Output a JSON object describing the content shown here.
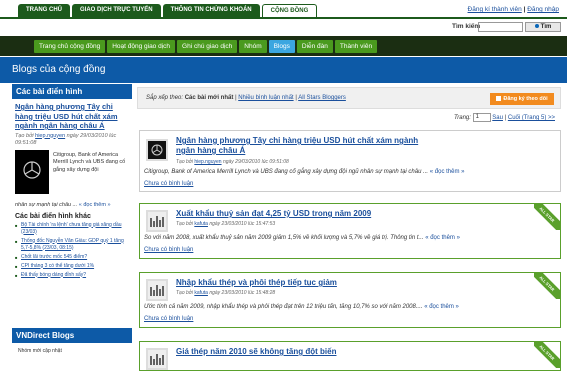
{
  "top_tabs": [
    "TRANG CHỦ",
    "GIAO DỊCH TRỰC TUYẾN",
    "THÔNG TIN CHỨNG KHOÁN",
    "CỘNG ĐỒNG"
  ],
  "top_links": {
    "register": "Đăng kí thành viên",
    "separator": "|",
    "login": "Đăng nhập"
  },
  "search": {
    "label": "Tìm kiếm",
    "placeholder": "",
    "button": "Tìm"
  },
  "green_nav": [
    "Trang chủ cộng đồng",
    "Hoạt động giao dịch",
    "Ghi chú giao dịch",
    "Nhóm",
    "Blogs",
    "Diễn đàn",
    "Thành viên"
  ],
  "page_title": "Blogs của cộng đồng",
  "sidebar": {
    "featured_header": "Các bài điển hình",
    "featured": {
      "title": "Ngân hàng phương Tây chi hàng triệu USD hút chất xám ngành ngân hàng châu Á",
      "meta_prefix": "Tạo bởi",
      "author": "hiep.nguyen",
      "meta_suffix": "ngày 29/03/2010 lúc 09:51:08",
      "text": "Citigroup, Bank of America Merrill Lynch và UBS đang cố gắng xây dựng đội",
      "tail": "nhân sự mạnh tại châu ...",
      "more": "« đọc thêm »"
    },
    "others_header": "Các bài điển hình khác",
    "others": [
      "Bộ Tài chính 'ra lệnh' chưa tăng giá xăng dầu (23/03)",
      "Thống đốc Nguyễn Văn Giàu: GDP quý 1 tăng 5,7-5,8% (23/03, 08:15)",
      "Chốt lãi trước mốc 545 điểm?",
      "CPI tháng 3 có thể tăng dưới 1%",
      "Đã thấy bóng dáng đỉnh sấy?"
    ],
    "blogs_header": "VNDirect Blogs",
    "blogs_bottom": "Nhóm mới cập nhật"
  },
  "sortbar": {
    "label": "Sắp xếp theo:",
    "newest": "Các bài mới nhất",
    "sep1": "|",
    "most_discussed": "Nhiều bình luận nhất",
    "sep2": "|",
    "all_bloggers": "All Stars Bloggers",
    "subscribe": "Đăng ký theo dõi"
  },
  "pager": {
    "label": "Trang:",
    "value": "1",
    "next": "Sau",
    "sep": "|",
    "last": "Cuối (Trang 5) >>"
  },
  "posts": [
    {
      "title": "Ngân hàng phương Tây chi hàng triệu USD hút chất xám ngành ngân hàng châu Á",
      "meta_prefix": "Tạo bởi",
      "author": "hiep.nguyen",
      "meta_suffix": "ngày 29/03/2010 lúc 09:51:08",
      "body": "Citigroup, Bank of America Merrill Lynch và UBS đang cố gắng xây dựng đội ngũ nhân sự mạnh tại châu ...",
      "more": "« đọc thêm »",
      "comment": "Chưa có bình luận"
    },
    {
      "title": "Xuất khẩu thuỷ sản đạt 4,25 tỷ USD trong năm 2009",
      "meta_prefix": "Tạo bởi",
      "author": "kafuta",
      "meta_suffix": "ngày 23/03/2010 lúc 15:47:53",
      "body": "So với năm 2008, xuất khẩu thuỷ sản năm 2009 giảm 1,5% về khối lượng và 5,7% về giá trị. Thông tin t...",
      "more": "« đọc thêm »",
      "comment": "Chưa có bình luận",
      "badge": "ALL STAR"
    },
    {
      "title": "Nhập khẩu thép và phôi thép tiếp tục giảm",
      "meta_prefix": "Tạo bởi",
      "author": "kafuta",
      "meta_suffix": "ngày 23/03/2010 lúc 15:48:28",
      "body": "Ước tính cả năm 2009, nhập khẩu thép và phôi thép đạt trên 12 triệu tấn, tăng 10,7% so với năm 2008....",
      "more": "« đọc thêm »",
      "comment": "Chưa có bình luận",
      "badge": "ALL STAR"
    },
    {
      "title": "Giá thép năm 2010 sẽ không tăng đột biến",
      "badge": "ALL STAR"
    }
  ]
}
